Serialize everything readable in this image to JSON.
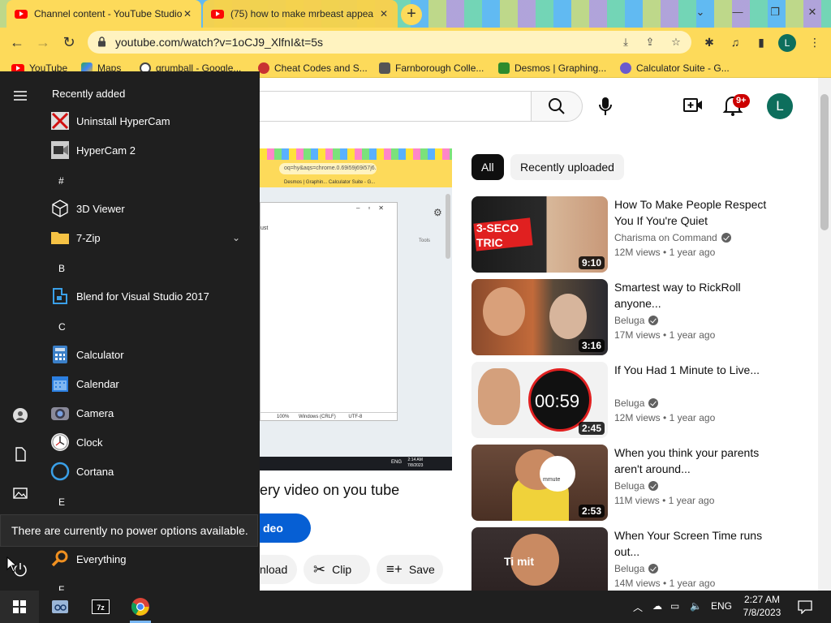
{
  "browser": {
    "tabs": [
      {
        "title": "Channel content - YouTube Studio",
        "active": true
      },
      {
        "title": "(75) how to make mrbeast appea",
        "active": false
      }
    ],
    "url": "youtube.com/watch?v=1oCJ9_XlfnI&t=5s",
    "profile_initial": "L",
    "bookmarks": [
      "YouTube",
      "Maps",
      "grumball - Google...",
      "Cheat Codes and S...",
      "Farnborough Colle...",
      "Desmos | Graphing...",
      "Calculator Suite - G..."
    ]
  },
  "youtube": {
    "notifications_badge": "9+",
    "avatar_initial": "L",
    "video_title_fragment": "ery video on you tube",
    "subscribe_fragment": "deo",
    "actions": {
      "download_fragment": "nload",
      "clip": "Clip",
      "save": "Save"
    },
    "chips": [
      "All",
      "Recently uploaded"
    ],
    "recommendations": [
      {
        "title": "How To Make People Respect You If You're Quiet",
        "channel": "Charisma on Command",
        "views": "12M views",
        "age": "1 year ago",
        "duration": "9:10",
        "thumb_text": "3-SECO TRIC"
      },
      {
        "title": "Smartest way to RickRoll anyone...",
        "channel": "Beluga",
        "views": "17M views",
        "age": "1 year ago",
        "duration": "3:16"
      },
      {
        "title": "If You Had 1 Minute to Live...",
        "channel": "Beluga",
        "views": "12M views",
        "age": "1 year ago",
        "duration": "2:45",
        "thumb_text": "00:59"
      },
      {
        "title": "When you think your parents aren't around...",
        "channel": "Beluga",
        "views": "11M views",
        "age": "1 year ago",
        "duration": "2:53",
        "thumb_text": "mmute"
      },
      {
        "title": "When Your Screen Time runs out...",
        "channel": "Beluga",
        "views": "14M views",
        "age": "1 year ago",
        "duration": "",
        "thumb_text": "Ti  mit"
      }
    ],
    "player": {
      "mini_url": " oq=hy&aqs=chrome.0.69i59j69i57j6...",
      "mini_bookmarks": "Desmos | Graphin...   Calculator Suite - G...",
      "mini_text": "ust",
      "mini_status": [
        "100%",
        "Windows (CRLF)",
        "UTF-8"
      ],
      "mini_menu": "Tools",
      "mini_clock": [
        "2:14 AM",
        "7/8/2023"
      ],
      "mini_tray": "ENG"
    }
  },
  "start_menu": {
    "header": "Recently added",
    "items": [
      {
        "label": "Uninstall HyperCam",
        "icon": "hypercam-uninstall-icon"
      },
      {
        "label": "HyperCam 2",
        "icon": "hypercam-icon"
      },
      {
        "letter": "#"
      },
      {
        "label": "3D Viewer",
        "icon": "3d-viewer-icon"
      },
      {
        "label": "7-Zip",
        "icon": "folder-icon",
        "expandable": true
      },
      {
        "letter": "B"
      },
      {
        "label": "Blend for Visual Studio 2017",
        "icon": "blend-icon"
      },
      {
        "letter": "C"
      },
      {
        "label": "Calculator",
        "icon": "calculator-icon"
      },
      {
        "label": "Calendar",
        "icon": "calendar-icon"
      },
      {
        "label": "Camera",
        "icon": "camera-icon"
      },
      {
        "label": "Clock",
        "icon": "clock-icon"
      },
      {
        "label": "Cortana",
        "icon": "cortana-icon"
      },
      {
        "letter": "E"
      },
      {
        "label": "Everything",
        "icon": "everything-icon"
      },
      {
        "letter": "F"
      }
    ],
    "power_tooltip": "There are currently no power options available."
  },
  "taskbar": {
    "language": "ENG",
    "time": "2:27 AM",
    "date": "7/8/2023"
  },
  "colors": {
    "chrome_theme": "#fdda5a",
    "start_menu_bg": "#1f1f1f",
    "youtube_red": "#ff0000",
    "subscribe_blue": "#065fd4"
  }
}
